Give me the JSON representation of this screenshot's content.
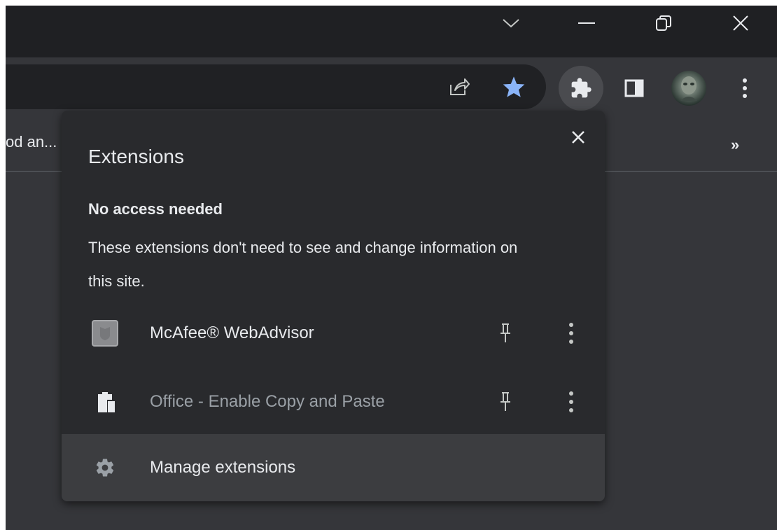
{
  "bookmarks_bar": {
    "truncated_item": "od an...",
    "overflow": "»"
  },
  "extensions_popup": {
    "title": "Extensions",
    "section_title": "No access needed",
    "section_description": "These extensions don't need to see and change information on this site.",
    "items": [
      {
        "name": "McAfee® WebAdvisor",
        "icon": "mcafee-icon",
        "enabled": true
      },
      {
        "name": "Office - Enable Copy and Paste",
        "icon": "clipboard-icon",
        "enabled": false
      }
    ],
    "manage_label": "Manage extensions"
  },
  "colors": {
    "titlebar": "#1f2023",
    "toolbar": "#35363a",
    "omnibox": "#202124",
    "popup_bg": "#292a2d",
    "popup_hover": "#3c3d40",
    "text_primary": "#e8eaed",
    "text_dim": "#9aa0a6",
    "star_accent": "#8ab4f8"
  }
}
